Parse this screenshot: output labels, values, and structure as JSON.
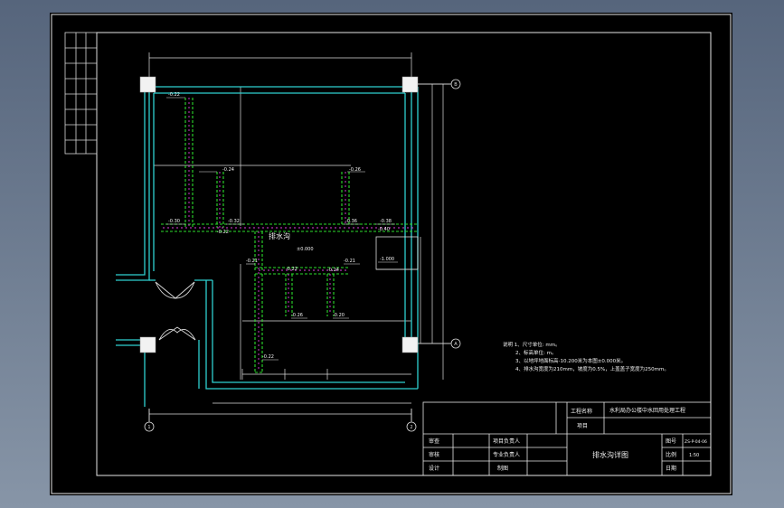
{
  "drawing": {
    "trench_label": "排水沟",
    "floor_level": "±0.000",
    "level_right": "-1.000",
    "levels": [
      "-0.22",
      "-0.24",
      "-0.26",
      "-0.30",
      "-0.32",
      "-0.36",
      "-0.38",
      "-0.40",
      "-0.22",
      "-0.21",
      "-0.21",
      "-0.22",
      "-0.26",
      "-0.20",
      "-0.22",
      "-0.24"
    ],
    "axis_top_right": "B",
    "axis_bottom_right": "A",
    "axis_bottom_left": "1",
    "axis_bottom_right_num": "2"
  },
  "notes": {
    "lines": [
      "说明 1、尺寸单位: mm。",
      "2、标高单位: m。",
      "3、以地坪地面标高-10.200米为本图±0.000米。",
      "4、排水沟宽度为210mm，坡度为0.5%，上盖盖子宽度为250mm。"
    ]
  },
  "title_block": {
    "project_name_label": "工程名称",
    "project_name": "水利局办公楼中水回用处理工程",
    "item_label": "项目",
    "item_value": "",
    "drawing_title": "排水沟详图",
    "review_label": "审查",
    "check_label": "审核",
    "design_label": "设计",
    "project_lead_label": "项目负责人",
    "discipline_lead_label": "专业负责人",
    "drafting_label": "制图",
    "drawing_no_label": "图号",
    "drawing_no": "ZS-P-04-06",
    "scale_label": "比例",
    "scale": "1:50",
    "date_label": "日期",
    "date": ""
  }
}
